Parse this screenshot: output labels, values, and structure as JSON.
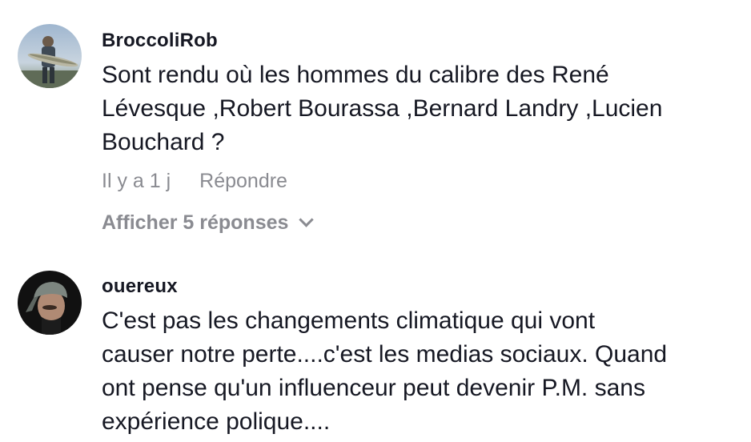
{
  "comments": [
    {
      "username": "BroccoliRob",
      "line1": "Sont rendu où les hommes du calibre des René",
      "line2": "Lévesque ,Robert Bourassa ,Bernard Landry ,Lucien",
      "line3": "Bouchard ?",
      "timestamp": "Il y a 1 j",
      "reply_label": "Répondre",
      "view_replies_label": "Afficher 5 réponses",
      "avatar_icon": "fisherman-holding-fish-avatar"
    },
    {
      "username": "ouereux",
      "line1": "C'est pas les changements climatique qui vont",
      "line2": "causer notre perte....c'est les medias sociaux. Quand",
      "line3": "ont pense qu'un influenceur peut devenir P.M. sans",
      "line4": "expérience polique....",
      "avatar_icon": "man-in-cap-avatar"
    }
  ]
}
